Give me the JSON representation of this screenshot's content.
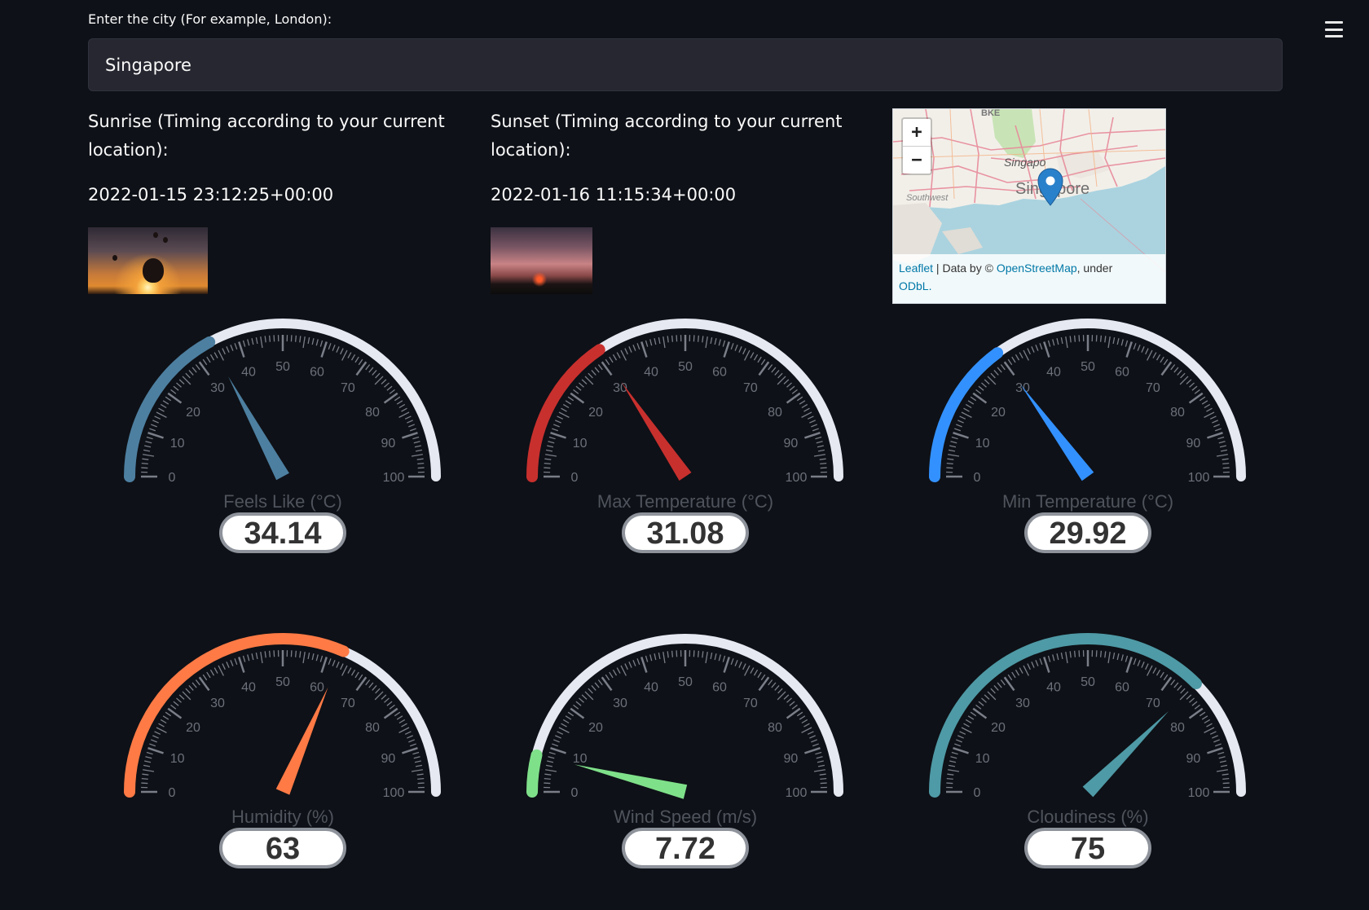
{
  "city": {
    "label": "Enter the city (For example, London):",
    "value": "Singapore"
  },
  "sunrise": {
    "label": "Sunrise (Timing according to your current location):",
    "time": "2022-01-15 23:12:25+00:00"
  },
  "sunset": {
    "label": "Sunset (Timing according to your current location):",
    "time": "2022-01-16 11:15:34+00:00"
  },
  "map": {
    "zoom_in": "+",
    "zoom_out": "−",
    "labels": {
      "top": "BKE",
      "city_small": "Singapo",
      "city_big": "Singapore",
      "southwest": "Southwest"
    },
    "attribution": {
      "leaflet": "Leaflet",
      "separator": " | Data by © ",
      "osm": "OpenStreetMap",
      "under": ", under",
      "odbl": "ODbL."
    }
  },
  "menu": {
    "icon": "hamburger-menu-icon"
  },
  "gauge_ticks": [
    "0",
    "10",
    "20",
    "30",
    "40",
    "50",
    "60",
    "70",
    "80",
    "90",
    "100"
  ],
  "gauges": [
    {
      "id": "feels-like",
      "title": "Feels Like (°C)",
      "value": 34.14,
      "display": "34.14",
      "color": "#4d7fa0"
    },
    {
      "id": "max-temp",
      "title": "Max Temperature (°C)",
      "value": 31.08,
      "display": "31.08",
      "color": "#c8302e"
    },
    {
      "id": "min-temp",
      "title": "Min Temperature (°C)",
      "value": 29.92,
      "display": "29.92",
      "color": "#3391ff"
    },
    {
      "id": "humidity",
      "title": "Humidity (%)",
      "value": 63,
      "display": "63",
      "color": "#ff7a45"
    },
    {
      "id": "wind-speed",
      "title": "Wind Speed (m/s)",
      "value": 7.72,
      "display": "7.72",
      "color": "#7fe08a"
    },
    {
      "id": "cloudiness",
      "title": "Cloudiness (%)",
      "value": 75,
      "display": "75",
      "color": "#4e9aa6"
    }
  ]
}
